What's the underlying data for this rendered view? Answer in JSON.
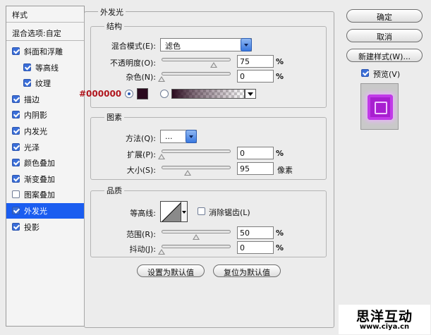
{
  "sidebar": {
    "header": "样式",
    "blend_options": "混合选项:自定",
    "items": [
      {
        "label": "斜面和浮雕",
        "checked": true
      },
      {
        "label": "等高线",
        "checked": true
      },
      {
        "label": "纹理",
        "checked": true
      },
      {
        "label": "描边",
        "checked": true
      },
      {
        "label": "内阴影",
        "checked": true
      },
      {
        "label": "内发光",
        "checked": true
      },
      {
        "label": "光泽",
        "checked": true
      },
      {
        "label": "颜色叠加",
        "checked": true
      },
      {
        "label": "渐变叠加",
        "checked": true
      },
      {
        "label": "图案叠加",
        "checked": false
      },
      {
        "label": "外发光",
        "checked": true,
        "selected": true
      },
      {
        "label": "投影",
        "checked": true
      }
    ]
  },
  "panel": {
    "title": "外发光",
    "structure": {
      "title": "结构",
      "blend_mode_label": "混合模式(E):",
      "blend_mode_value": "滤色",
      "opacity_label": "不透明度(O):",
      "opacity_value": "75",
      "opacity_level": 75,
      "noise_label": "杂色(N):",
      "noise_value": "0",
      "noise_level": 0,
      "percent": "%",
      "color_hex_label": "#000000",
      "glow_color": "#2a0a1e"
    },
    "elements": {
      "title": "图素",
      "technique_label": "方法(Q):",
      "technique_value": "...",
      "spread_label": "扩展(P):",
      "spread_value": "0",
      "spread_level": 0,
      "size_label": "大小(S):",
      "size_value": "95",
      "size_unit": "像素",
      "size_level": 38,
      "percent": "%"
    },
    "quality": {
      "title": "品质",
      "contour_label": "等高线:",
      "anti_alias_label": "消除锯齿(L)",
      "anti_alias_checked": false,
      "range_label": "范围(R):",
      "range_value": "50",
      "range_level": 50,
      "jitter_label": "抖动(J):",
      "jitter_value": "0",
      "jitter_level": 0,
      "percent": "%"
    },
    "set_default": "设置为默认值",
    "reset_default": "复位为默认值"
  },
  "actions": {
    "ok": "确定",
    "cancel": "取消",
    "new_style": "新建样式(W)...",
    "preview_label": "预览(V)",
    "preview_checked": true
  },
  "watermark": {
    "title": "思洋互动",
    "url": "www.ciya.cn"
  },
  "colors": {
    "selection": "#1b5df0",
    "hex_label": "#b0161e",
    "preview_gem": "#a81fd0"
  }
}
